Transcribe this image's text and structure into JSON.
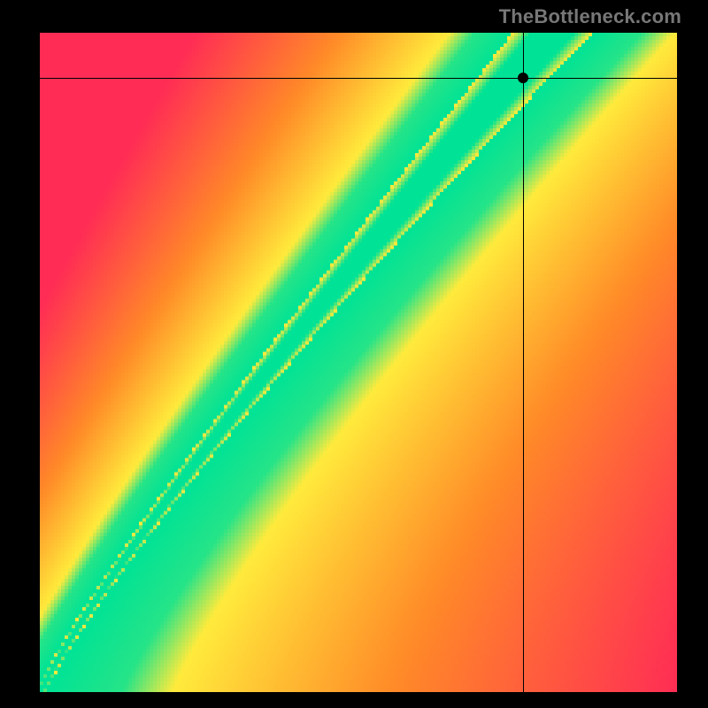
{
  "watermark": "TheBottleneck.com",
  "crosshair": {
    "x_frac": 0.758,
    "y_frac": 0.068
  },
  "chart_data": {
    "type": "heatmap",
    "title": "",
    "xlabel": "",
    "ylabel": "",
    "xlim": [
      0,
      1
    ],
    "ylim": [
      0,
      1
    ],
    "marker": {
      "x": 0.758,
      "y": 0.932,
      "note": "black dot at crosshair intersection; y measured from bottom"
    },
    "optimal_curve": {
      "note": "approximate center of the green optimal band, parameterized by t in [0,1] for the visible portion",
      "x": [
        0.0,
        0.05,
        0.1,
        0.2,
        0.3,
        0.4,
        0.5,
        0.6,
        0.7,
        0.8
      ],
      "y": [
        0.0,
        0.025,
        0.055,
        0.14,
        0.25,
        0.39,
        0.54,
        0.7,
        0.86,
        1.0
      ]
    },
    "color_bands": {
      "green": "optimal / no bottleneck",
      "yellow": "near-optimal",
      "orange_red": "bottlenecked region"
    }
  }
}
